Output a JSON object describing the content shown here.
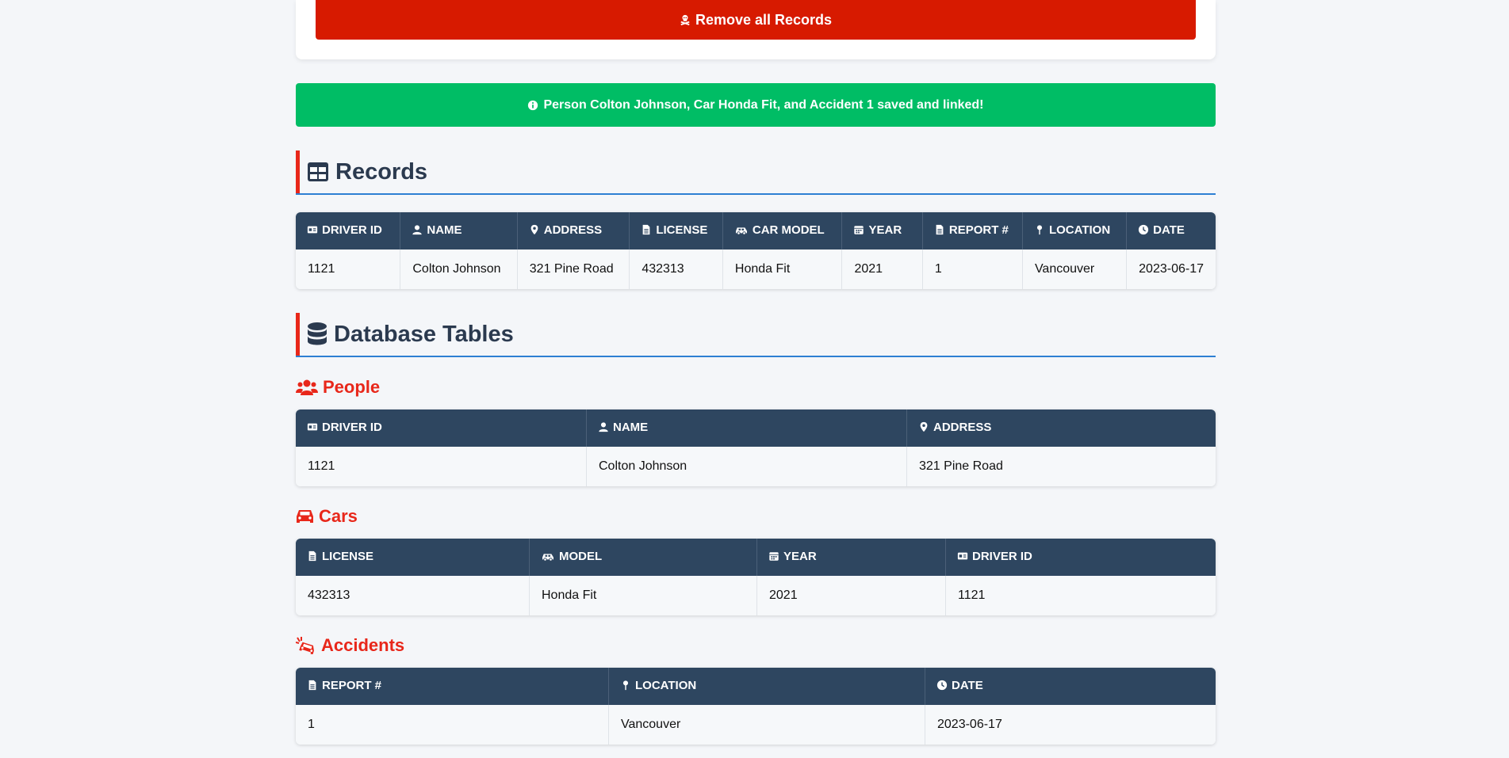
{
  "top": {
    "remove_label": "Remove all Records"
  },
  "alert": {
    "message": "Person Colton Johnson, Car Honda Fit, and Accident 1 saved and linked!"
  },
  "records": {
    "title": "Records",
    "columns": [
      "DRIVER ID",
      "NAME",
      "ADDRESS",
      "LICENSE",
      "CAR MODEL",
      "YEAR",
      "REPORT #",
      "LOCATION",
      "DATE"
    ],
    "rows": [
      [
        "1121",
        "Colton Johnson",
        "321 Pine Road",
        "432313",
        "Honda Fit",
        "2021",
        "1",
        "Vancouver",
        "2023-06-17"
      ]
    ]
  },
  "db": {
    "title": "Database Tables",
    "people": {
      "title": "People",
      "columns": [
        "DRIVER ID",
        "NAME",
        "ADDRESS"
      ],
      "rows": [
        [
          "1121",
          "Colton Johnson",
          "321 Pine Road"
        ]
      ]
    },
    "cars": {
      "title": "Cars",
      "columns": [
        "LICENSE",
        "MODEL",
        "YEAR",
        "DRIVER ID"
      ],
      "rows": [
        [
          "432313",
          "Honda Fit",
          "2021",
          "1121"
        ]
      ]
    },
    "accidents": {
      "title": "Accidents",
      "columns": [
        "REPORT #",
        "LOCATION",
        "DATE"
      ],
      "rows": [
        [
          "1",
          "Vancouver",
          "2023-06-17"
        ]
      ]
    }
  },
  "colors": {
    "danger": "#d71a00",
    "success": "#00bd65",
    "header": "#2e4660",
    "accent": "#e8271a",
    "rule": "#2d7fd3"
  },
  "icons": {
    "remove": "skull-crossbones-icon",
    "alert": "info-circle-icon",
    "records": "table-icon",
    "db": "database-icon",
    "people": "users-icon",
    "cars": "car-icon",
    "accidents": "car-crash-icon"
  }
}
